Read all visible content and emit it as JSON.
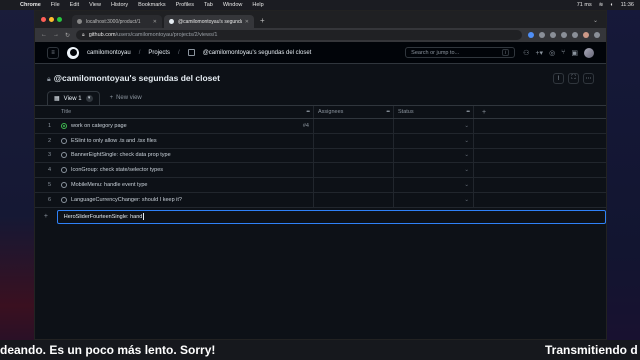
{
  "menubar": {
    "app": "Chrome",
    "items": [
      "File",
      "Edit",
      "View",
      "History",
      "Bookmarks",
      "Profiles",
      "Tab",
      "Window",
      "Help"
    ],
    "network": "71 ms",
    "clock": "11:36"
  },
  "browser": {
    "tabs": [
      {
        "label": "localhost:3000/product/1"
      },
      {
        "label": "@camilomontoyau's segundas del…"
      }
    ],
    "url_host": "github.com",
    "url_path": "/users/camilomontoyau/projects/2/views/1"
  },
  "github": {
    "user": "camilomontoyau",
    "sep": "/",
    "section": "Projects",
    "project_crumb": "@camilomontoyau's segundas del closet",
    "search_placeholder": "Search or jump to...",
    "search_key": "/"
  },
  "project": {
    "title": "@camilomontoyau's segundas del closet",
    "views": [
      {
        "label": "View 1"
      }
    ],
    "new_view_label": "New view"
  },
  "table": {
    "columns": {
      "title": "Title",
      "assignees": "Assignees",
      "status": "Status"
    },
    "rows": [
      {
        "num": "1",
        "title": "work on category page",
        "issue": "#4",
        "state": "open"
      },
      {
        "num": "2",
        "title": "ESlint to only allow .ts and .tsx files",
        "issue": "",
        "state": "draft"
      },
      {
        "num": "3",
        "title": "BannerEightSingle: check data prop type",
        "issue": "",
        "state": "draft"
      },
      {
        "num": "4",
        "title": "IconGroup: check state/selector types",
        "issue": "",
        "state": "draft"
      },
      {
        "num": "5",
        "title": "MobileMenu: handle event type",
        "issue": "",
        "state": "draft"
      },
      {
        "num": "6",
        "title": "LanguageCurrencyChanger: should I keep it?",
        "issue": "",
        "state": "draft"
      }
    ],
    "new_item_value": "HeroSliderFourteenSingle: hand",
    "add_symbol": "+"
  },
  "stream": {
    "ticker_left": "deando. Es un poco más lento. Sorry!",
    "ticker_right": "Transmitiendo d"
  },
  "colors": {
    "accent": "#2f81f7",
    "open_issue": "#3fb950",
    "bg": "#0d1117"
  }
}
